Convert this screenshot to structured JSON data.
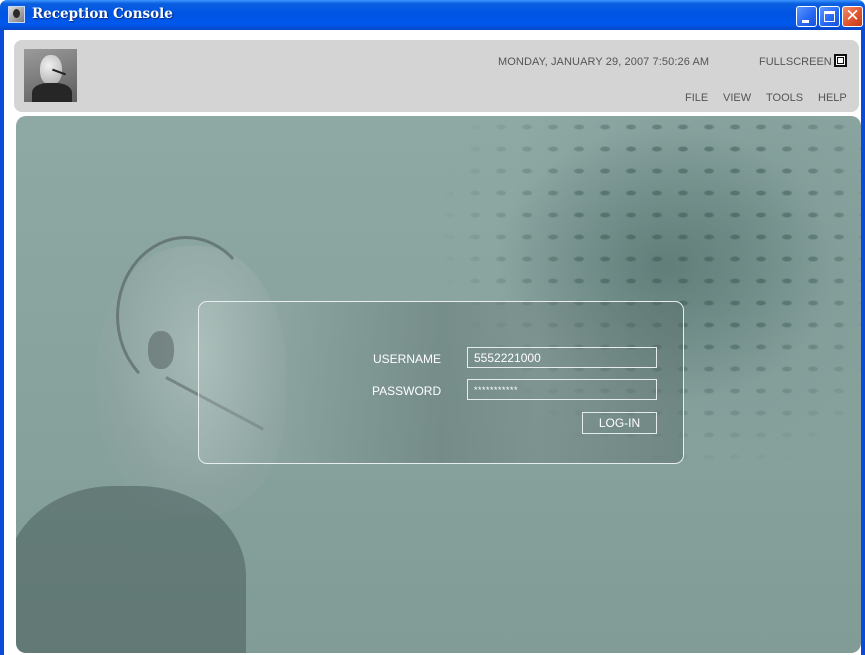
{
  "window": {
    "title": "Reception Console",
    "icon": "headset-person-icon"
  },
  "header": {
    "datetime": "MONDAY, JANUARY 29, 2007 7:50:26 AM",
    "fullscreen_label": "FULLSCREEN",
    "menu": [
      "FILE",
      "VIEW",
      "TOOLS",
      "HELP"
    ]
  },
  "login": {
    "username_label": "USERNAME",
    "username_value": "5552221000",
    "password_label": "PASSWORD",
    "password_value": "***********",
    "login_button": "LOG-IN"
  },
  "colors": {
    "titlebar": "#0054e3",
    "background": "#87a19d",
    "header_panel": "#d4d4d4"
  }
}
